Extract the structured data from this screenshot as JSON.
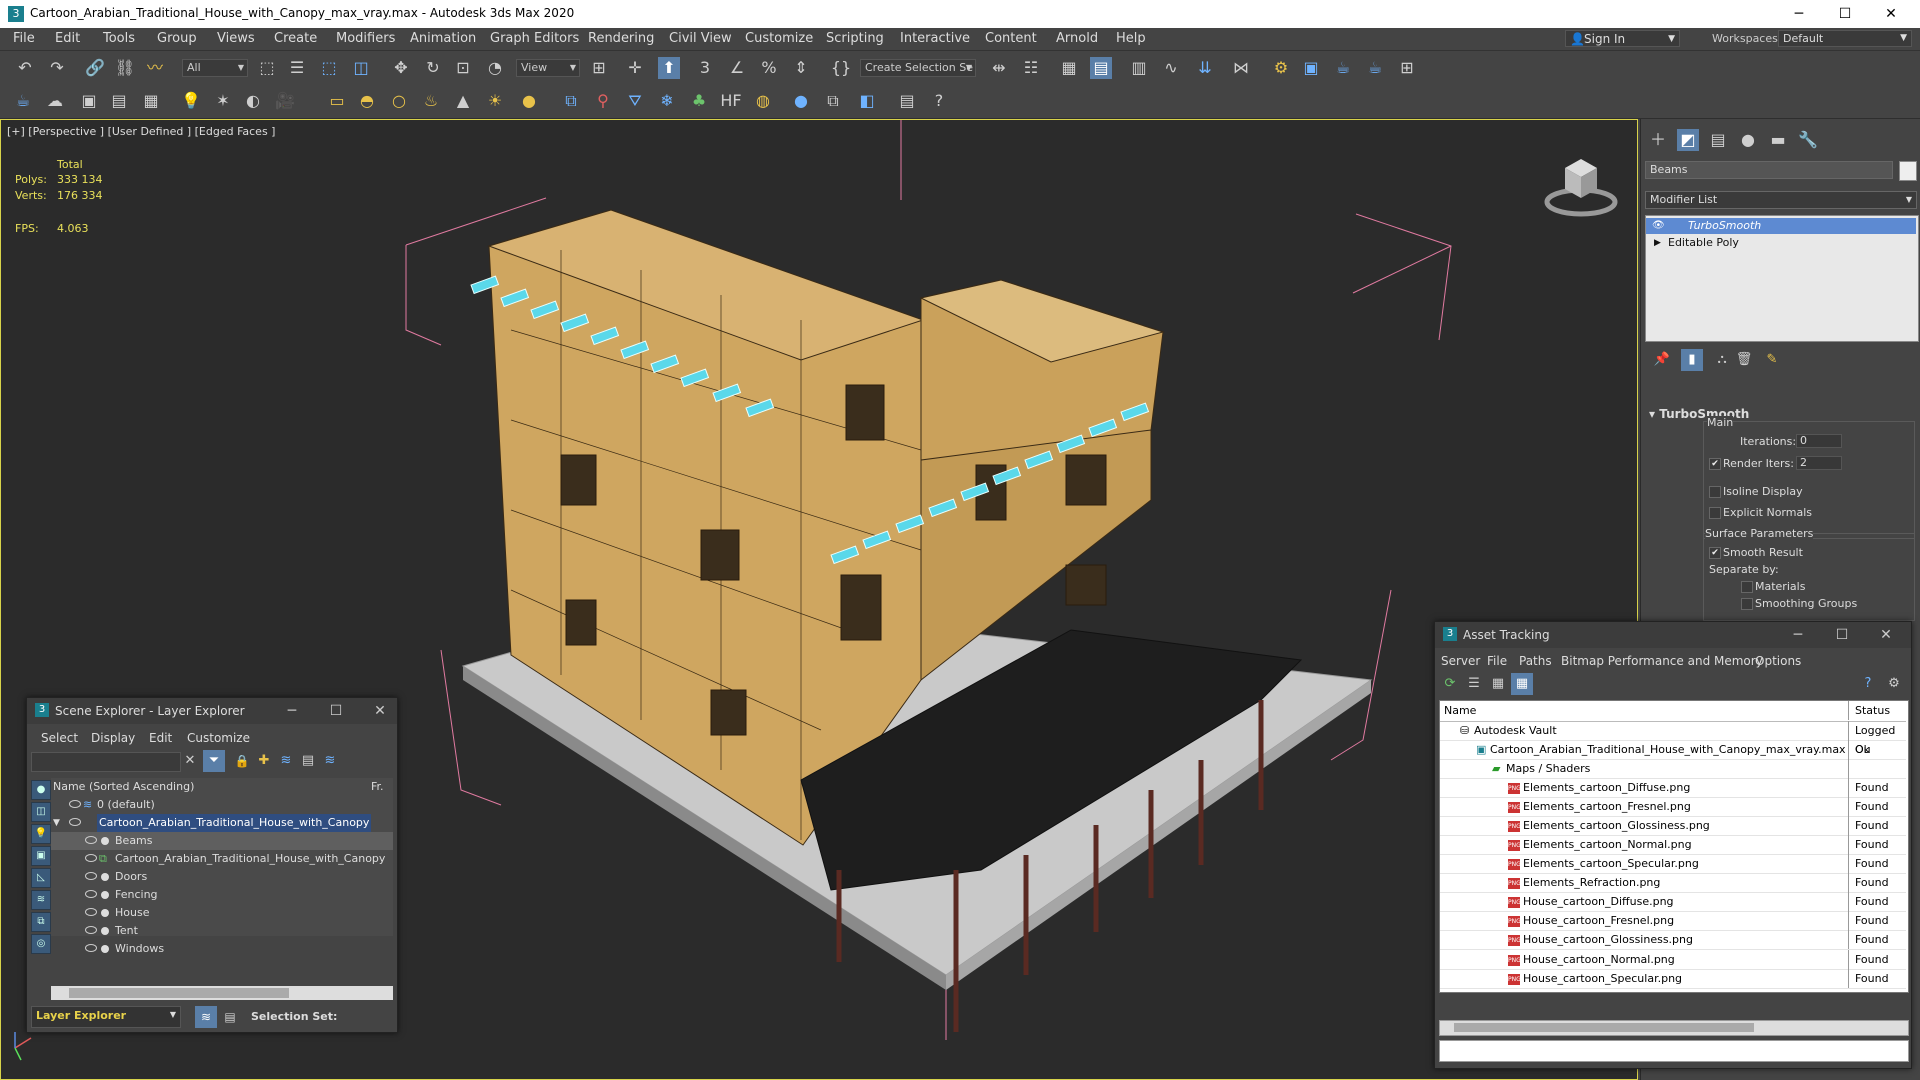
{
  "window": {
    "title": "Cartoon_Arabian_Traditional_House_with_Canopy_max_vray.max - Autodesk 3ds Max 2020",
    "app_icon": "3",
    "minimize": "─",
    "maximize": "☐",
    "close": "✕"
  },
  "menu": [
    "File",
    "Edit",
    "Tools",
    "Group",
    "Views",
    "Create",
    "Modifiers",
    "Animation",
    "Graph Editors",
    "Rendering",
    "Civil View",
    "Customize",
    "Scripting",
    "Interactive",
    "Content",
    "Arnold",
    "Help"
  ],
  "signin": "Sign In",
  "workspaces_label": "Workspaces:",
  "workspaces_value": "Default",
  "toolbar": {
    "selection_filter": "All",
    "ref_coord": "View",
    "named_selection": "Create Selection Se"
  },
  "viewport": {
    "label": "[+] [Perspective ] [User Defined ] [Edged Faces ]",
    "stats": {
      "total_label": "Total",
      "polys_label": "Polys:",
      "polys": "333 134",
      "verts_label": "Verts:",
      "verts": "176 334",
      "fps_label": "FPS:",
      "fps": "4.063"
    }
  },
  "command_panel": {
    "object_name": "Beams",
    "modifier_list": "Modifier List",
    "stack": [
      "TurboSmooth",
      "Editable Poly"
    ],
    "rollout_title": "TurboSmooth",
    "main_label": "Main",
    "iterations_label": "Iterations:",
    "iterations": "0",
    "render_iters_label": "Render Iters:",
    "render_iters": "2",
    "isoline": "Isoline Display",
    "explicit_normals": "Explicit Normals",
    "surface_params": "Surface Parameters",
    "smooth_result": "Smooth Result",
    "separate_by": "Separate by:",
    "materials": "Materials",
    "smoothing_groups": "Smoothing Groups"
  },
  "scene_explorer": {
    "title": "Scene Explorer - Layer Explorer",
    "menus": [
      "Select",
      "Display",
      "Edit",
      "Customize"
    ],
    "column_name": "Name (Sorted Ascending)",
    "column_fr": "Fr.",
    "rows": [
      {
        "label": "0 (default)",
        "level": 0
      },
      {
        "label": "Cartoon_Arabian_Traditional_House_with_Canopy",
        "level": 0
      },
      {
        "label": "Beams",
        "level": 1
      },
      {
        "label": "Cartoon_Arabian_Traditional_House_with_Canopy",
        "level": 1
      },
      {
        "label": "Doors",
        "level": 1
      },
      {
        "label": "Fencing",
        "level": 1
      },
      {
        "label": "House",
        "level": 1
      },
      {
        "label": "Tent",
        "level": 1
      },
      {
        "label": "Windows",
        "level": 1
      }
    ],
    "footer_dropdown": "Layer Explorer",
    "selection_set": "Selection Set:"
  },
  "asset_tracking": {
    "title": "Asset Tracking",
    "menus": [
      "Server",
      "File",
      "Paths",
      "Bitmap Performance and Memory",
      "Options"
    ],
    "col_name": "Name",
    "col_status": "Status",
    "rows": [
      {
        "name": "Autodesk Vault",
        "status": "Logged Ou"
      },
      {
        "name": "Cartoon_Arabian_Traditional_House_with_Canopy_max_vray.max",
        "status": "Ok"
      },
      {
        "name": "Maps / Shaders",
        "status": ""
      },
      {
        "name": "Elements_cartoon_Diffuse.png",
        "status": "Found"
      },
      {
        "name": "Elements_cartoon_Fresnel.png",
        "status": "Found"
      },
      {
        "name": "Elements_cartoon_Glossiness.png",
        "status": "Found"
      },
      {
        "name": "Elements_cartoon_Normal.png",
        "status": "Found"
      },
      {
        "name": "Elements_cartoon_Specular.png",
        "status": "Found"
      },
      {
        "name": "Elements_Refraction.png",
        "status": "Found"
      },
      {
        "name": "House_cartoon_Diffuse.png",
        "status": "Found"
      },
      {
        "name": "House_cartoon_Fresnel.png",
        "status": "Found"
      },
      {
        "name": "House_cartoon_Glossiness.png",
        "status": "Found"
      },
      {
        "name": "House_cartoon_Normal.png",
        "status": "Found"
      },
      {
        "name": "House_cartoon_Specular.png",
        "status": "Found"
      }
    ]
  }
}
